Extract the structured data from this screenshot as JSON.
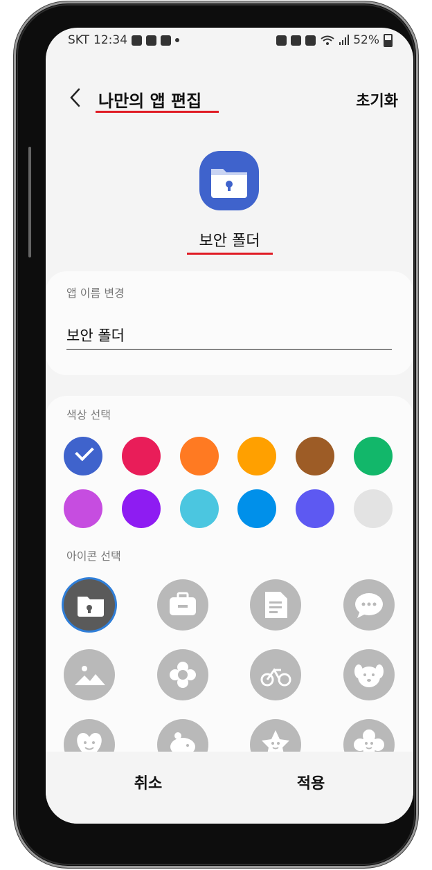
{
  "statusbar": {
    "carrier": "SKT",
    "time": "12:34",
    "battery": "52%"
  },
  "header": {
    "title": "나만의 앱 편집",
    "reset_label": "초기화"
  },
  "app": {
    "name": "보안 폴더",
    "icon_color": "#3f63cc"
  },
  "rename": {
    "label": "앱 이름 변경",
    "value": "보안 폴더"
  },
  "colors": {
    "label": "색상 선택",
    "swatches": [
      "#3f63cc",
      "#e91d59",
      "#ff7a22",
      "#ffa000",
      "#9d5c26",
      "#12b76a",
      "#c64de0",
      "#8e1cf2",
      "#4bc6e0",
      "#0090ea",
      "#5d59f2",
      "#e3e3e3"
    ],
    "selected_index": 0
  },
  "icons": {
    "label": "아이콘 선택",
    "items": [
      "folder-lock-icon",
      "briefcase-icon",
      "document-icon",
      "chat-icon",
      "picture-icon",
      "flower-icon",
      "bicycle-icon",
      "dog-icon",
      "heart-face-icon",
      "pig-icon",
      "star-face-icon",
      "flower-face-icon"
    ],
    "selected_index": 0
  },
  "actions": {
    "cancel_label": "취소",
    "apply_label": "적용"
  },
  "accent": {
    "underline": "#e01b24",
    "selection_ring": "#2f7ed8"
  }
}
